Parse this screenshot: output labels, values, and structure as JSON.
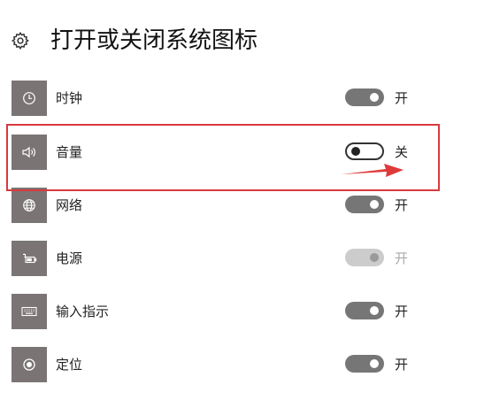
{
  "page": {
    "title": "打开或关闭系统图标"
  },
  "icons": {
    "settings": "gear-icon"
  },
  "items": [
    {
      "label": "时钟",
      "icon": "clock-icon",
      "state": "on",
      "state_label": "开"
    },
    {
      "label": "音量",
      "icon": "volume-icon",
      "state": "off",
      "state_label": "关"
    },
    {
      "label": "网络",
      "icon": "network-icon",
      "state": "on",
      "state_label": "开"
    },
    {
      "label": "电源",
      "icon": "battery-icon",
      "state": "disabled",
      "state_label": "开"
    },
    {
      "label": "输入指示",
      "icon": "keyboard-icon",
      "state": "on",
      "state_label": "开"
    },
    {
      "label": "定位",
      "icon": "location-icon",
      "state": "on",
      "state_label": "开"
    }
  ],
  "colors": {
    "tile": "#7a7574",
    "toggle_on": "#767676",
    "toggle_disabled": "#cccccc",
    "highlight": "#d9393e"
  }
}
